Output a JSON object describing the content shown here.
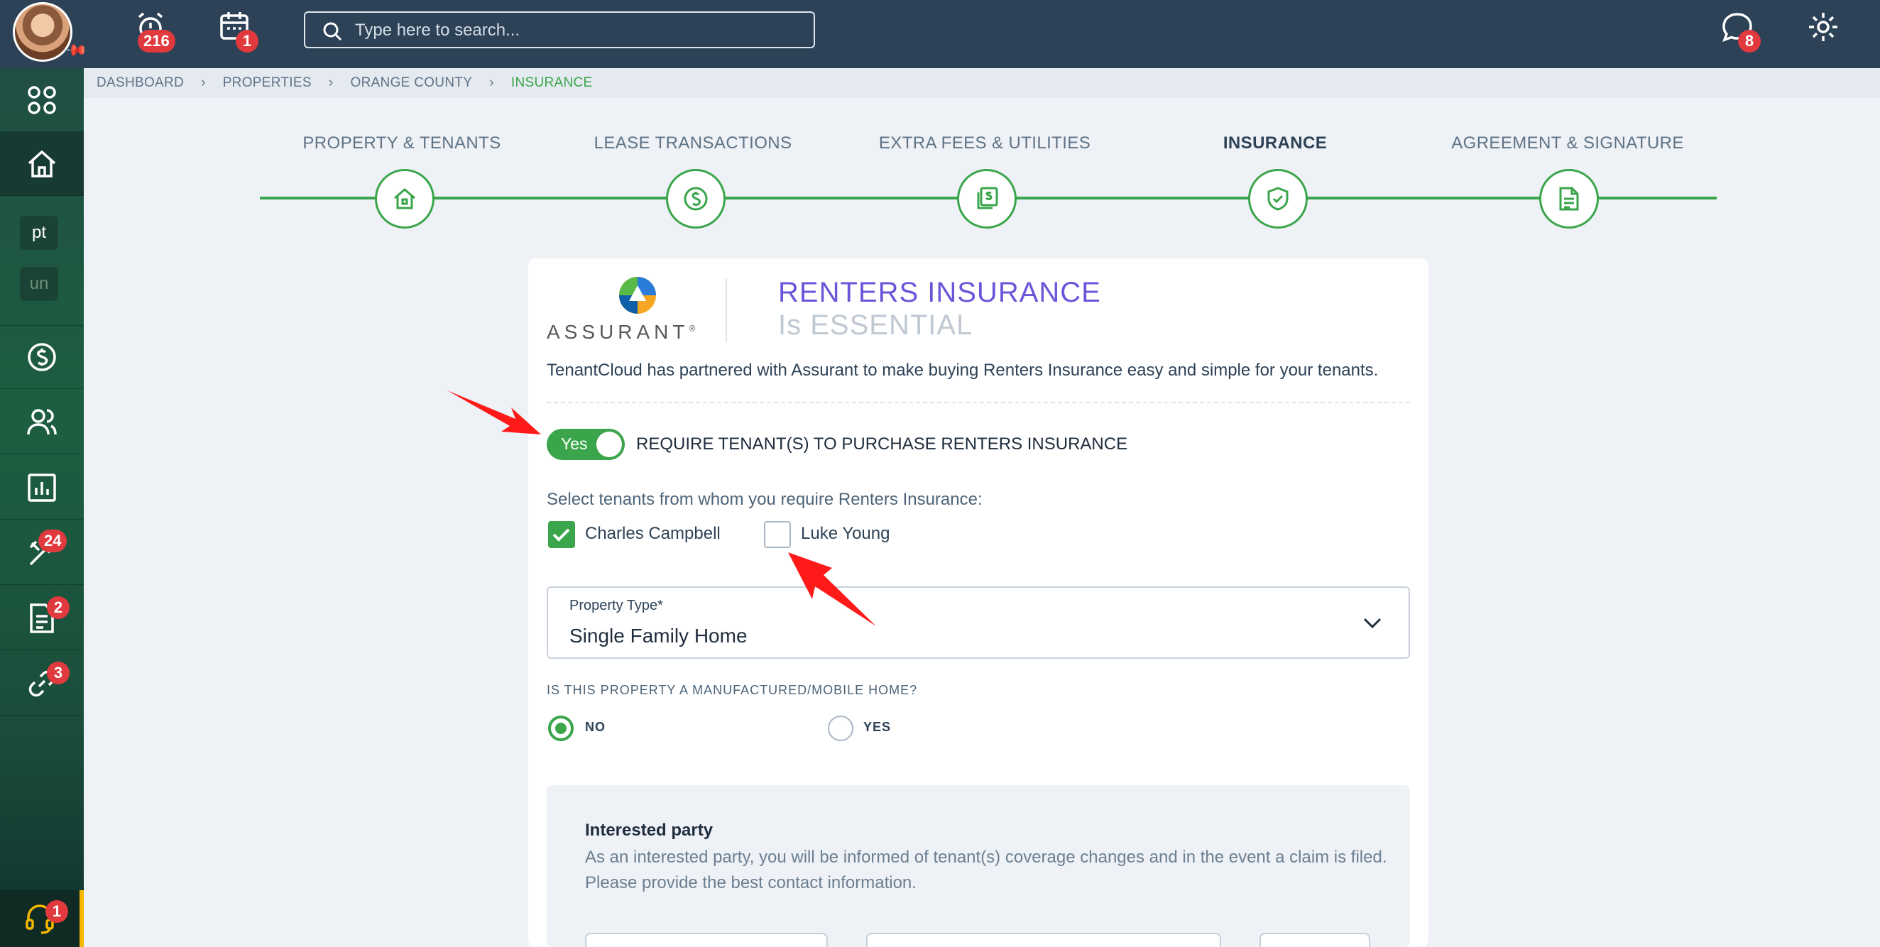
{
  "topbar": {
    "alerts_badge": "216",
    "calendar_badge": "1",
    "search_placeholder": "Type here to search...",
    "messages_badge": "8"
  },
  "sidebar": {
    "chip_pt": "pt",
    "chip_un": "un",
    "maintenance_badge": "24",
    "documents_badge": "2",
    "links_badge": "3",
    "support_badge": "1"
  },
  "breadcrumb": [
    "DASHBOARD",
    "PROPERTIES",
    "ORANGE COUNTY",
    "INSURANCE"
  ],
  "steps": [
    {
      "label": "PROPERTY & TENANTS",
      "icon": "home-icon"
    },
    {
      "label": "LEASE TRANSACTIONS",
      "icon": "dollar-icon"
    },
    {
      "label": "EXTRA FEES & UTILITIES",
      "icon": "bills-icon"
    },
    {
      "label": "INSURANCE",
      "icon": "shield-check-icon",
      "active": true
    },
    {
      "label": "AGREEMENT & SIGNATURE",
      "icon": "document-icon"
    }
  ],
  "insurance": {
    "logo_text": "ASSURANT",
    "logo_reg": "®",
    "title": "RENTERS INSURANCE",
    "subtitle": "Is ESSENTIAL",
    "intro": "TenantCloud has partnered with Assurant to make buying Renters Insurance easy and simple for your tenants.",
    "toggle_label": "Yes",
    "toggle_on": true,
    "require_label": "REQUIRE TENANT(S) TO PURCHASE RENTERS INSURANCE",
    "select_label": "Select tenants from whom you require Renters Insurance:",
    "tenants": [
      {
        "name": "Charles Campbell",
        "checked": true
      },
      {
        "name": "Luke Young",
        "checked": false
      }
    ],
    "property_type_label": "Property Type*",
    "property_type_value": "Single Family Home",
    "mobile_home_question": "IS THIS PROPERTY A MANUFACTURED/MOBILE HOME?",
    "radio_no": "NO",
    "radio_yes": "YES",
    "radio_selected": "NO",
    "interested_title": "Interested party",
    "interested_text": "As an interested party, you will be informed of tenant(s) coverage changes and in the event a claim is filed. Please provide the best contact information."
  },
  "colors": {
    "accent_green": "#3aa54b",
    "topbar": "#2d4257",
    "badge_red": "#e0393e",
    "title_purple": "#6b55d8",
    "arrow_red": "#ff1a1a"
  }
}
